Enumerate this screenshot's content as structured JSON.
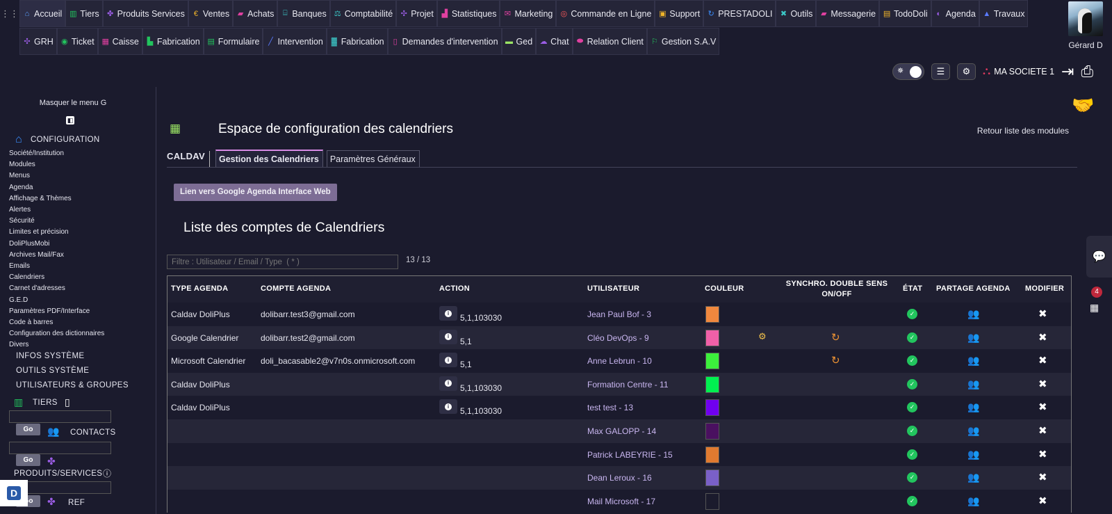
{
  "nav_row1": [
    {
      "label": "Accueil",
      "icon": "⌂",
      "color": "#5aa0ff",
      "active": true
    },
    {
      "label": "Tiers",
      "icon": "▥",
      "color": "#22c55e"
    },
    {
      "label": "Produits Services",
      "icon": "✤",
      "color": "#9b5de5"
    },
    {
      "label": "Ventes",
      "icon": "€",
      "color": "#f0b429"
    },
    {
      "label": "Achats",
      "icon": "▰",
      "color": "#e040a0"
    },
    {
      "label": "Banques",
      "icon": "⌸",
      "color": "#3cc8c8"
    },
    {
      "label": "Comptabilité",
      "icon": "⚖",
      "color": "#3cc8c8"
    },
    {
      "label": "Projet",
      "icon": "✣",
      "color": "#9b5de5"
    },
    {
      "label": "Statistiques",
      "icon": "▟",
      "color": "#e040a0"
    },
    {
      "label": "Marketing",
      "icon": "✉",
      "color": "#e040a0"
    },
    {
      "label": "Commande en Ligne",
      "icon": "◎",
      "color": "#ff5a5a"
    },
    {
      "label": "Support",
      "icon": "▣",
      "color": "#f0b429"
    },
    {
      "label": "PRESTADOLI",
      "icon": "↻",
      "color": "#3b8fff"
    },
    {
      "label": "Outils",
      "icon": "✖",
      "color": "#3cc8c8"
    },
    {
      "label": "Messagerie",
      "icon": "▰",
      "color": "#e040a0"
    },
    {
      "label": "TodoDoli",
      "icon": "▤",
      "color": "#f0b429"
    },
    {
      "label": "Agenda",
      "icon": "◐",
      "color": "#9b5de5"
    },
    {
      "label": "Travaux",
      "icon": "▲",
      "color": "#5a7bff"
    }
  ],
  "nav_row2": [
    {
      "label": "GRH",
      "icon": "✣",
      "color": "#9b5de5"
    },
    {
      "label": "Ticket",
      "icon": "◉",
      "color": "#22c55e"
    },
    {
      "label": "Caisse",
      "icon": "▦",
      "color": "#e040a0"
    },
    {
      "label": "Fabrication",
      "icon": "▙",
      "color": "#22c55e"
    },
    {
      "label": "Formulaire",
      "icon": "▤",
      "color": "#22c55e"
    },
    {
      "label": "Intervention",
      "icon": "╱",
      "color": "#5a7bff"
    },
    {
      "label": "Fabrication",
      "icon": "▓",
      "color": "#3cc8c8"
    },
    {
      "label": "Demandes d'intervention",
      "icon": "▯",
      "color": "#e040a0"
    },
    {
      "label": "Ged",
      "icon": "▬",
      "color": "#9be564"
    },
    {
      "label": "Chat",
      "icon": "☁",
      "color": "#9b5de5"
    },
    {
      "label": "Relation Client",
      "icon": "⬬",
      "color": "#e040a0"
    },
    {
      "label": "Gestion S.A.V",
      "icon": "⚐",
      "color": "#22c55e"
    }
  ],
  "user": {
    "name": "Gérard D"
  },
  "company": {
    "name": "MA SOCIETE 1"
  },
  "sidebar": {
    "hide_menu": "Masquer le menu G",
    "configuration": "CONFIGURATION",
    "config_items": [
      "Société/Institution",
      "Modules",
      "Menus",
      "Agenda",
      "Affichage & Thèmes",
      "Alertes",
      "Sécurité",
      "Limites et précision",
      "DoliPlusMobi",
      "Archives Mail/Fax",
      "Emails",
      "Calendriers",
      "Carnet d'adresses",
      "G.E.D",
      "Paramètres PDF/Interface",
      "Code à barres",
      "Configuration des dictionnaires",
      "Divers"
    ],
    "infos": "INFOS SYSTÈME",
    "outils": "OUTILS SYSTÈME",
    "users": "UTILISATEURS & GROUPES",
    "tiers": "TIERS",
    "contacts": "CONTACTS",
    "produits": "PRODUITS/SERVICES",
    "ref": "REF",
    "go": "Go"
  },
  "page": {
    "title": "Espace de configuration des calendriers",
    "back": "Retour liste des modules",
    "tab_caldav": "CALDAV",
    "tab_gestion": "Gestion des Calendriers",
    "tab_params": "Paramètres Généraux",
    "google_button": "Lien vers Google Agenda Interface Web",
    "list_title": "Liste des comptes de Calendriers",
    "filter_placeholder": "Filtre : Utilisateur / Email / Type  ( * )",
    "count": "13 / 13"
  },
  "table": {
    "headers": {
      "type": "TYPE AGENDA",
      "compte": "COMPTE AGENDA",
      "action": "ACTION",
      "user": "UTILISATEUR",
      "couleur": "COULEUR",
      "sync1": "SYNCHRO. DOUBLE SENS",
      "sync2": "ON/OFF",
      "etat": "ÉTAT",
      "partage": "PARTAGE AGENDA",
      "modifier": "MODIFIER"
    },
    "rows": [
      {
        "type": "Caldav DoliPlus",
        "compte": "dolibarr.test3@gmail.com",
        "action": "5,1,103030",
        "user": "Jean Paul Bof - 3",
        "color": "#f0883e",
        "sync": false,
        "usericon": false
      },
      {
        "type": "Google Calendrier",
        "compte": "dolibarr.test2@gmail.com",
        "action": "5,1",
        "user": "Cléo DevOps - 9",
        "color": "#f060a8",
        "sync": true,
        "usericon": true
      },
      {
        "type": "Microsoft Calendrier",
        "compte": "doli_bacasable2@v7n0s.onmicrosoft.com",
        "action": "5,1",
        "user": "Anne Lebrun - 10",
        "color": "#3cf03c",
        "sync": true,
        "usericon": false
      },
      {
        "type": "Caldav DoliPlus",
        "compte": "",
        "action": "5,1,103030",
        "user": "Formation Centre - 11",
        "color": "#00f050",
        "sync": false,
        "usericon": false
      },
      {
        "type": "Caldav DoliPlus",
        "compte": "",
        "action": "5,1,103030",
        "user": "test test - 13",
        "color": "#7000f0",
        "sync": false,
        "usericon": false
      },
      {
        "type": "",
        "compte": "",
        "action": "",
        "user": "Max GALOPP - 14",
        "color": "#4a1060",
        "sync": false,
        "usericon": false
      },
      {
        "type": "",
        "compte": "",
        "action": "",
        "user": "Patrick LABEYRIE - 15",
        "color": "#e07a30",
        "sync": false,
        "usericon": false
      },
      {
        "type": "",
        "compte": "",
        "action": "",
        "user": "Dean Leroux - 16",
        "color": "#7a60c8",
        "sync": false,
        "usericon": false
      },
      {
        "type": "",
        "compte": "",
        "action": "",
        "user": "Mail Microsoft - 17",
        "color": "#1b1b2d",
        "sync": false,
        "usericon": false
      }
    ]
  },
  "notifications": {
    "count": "4"
  }
}
